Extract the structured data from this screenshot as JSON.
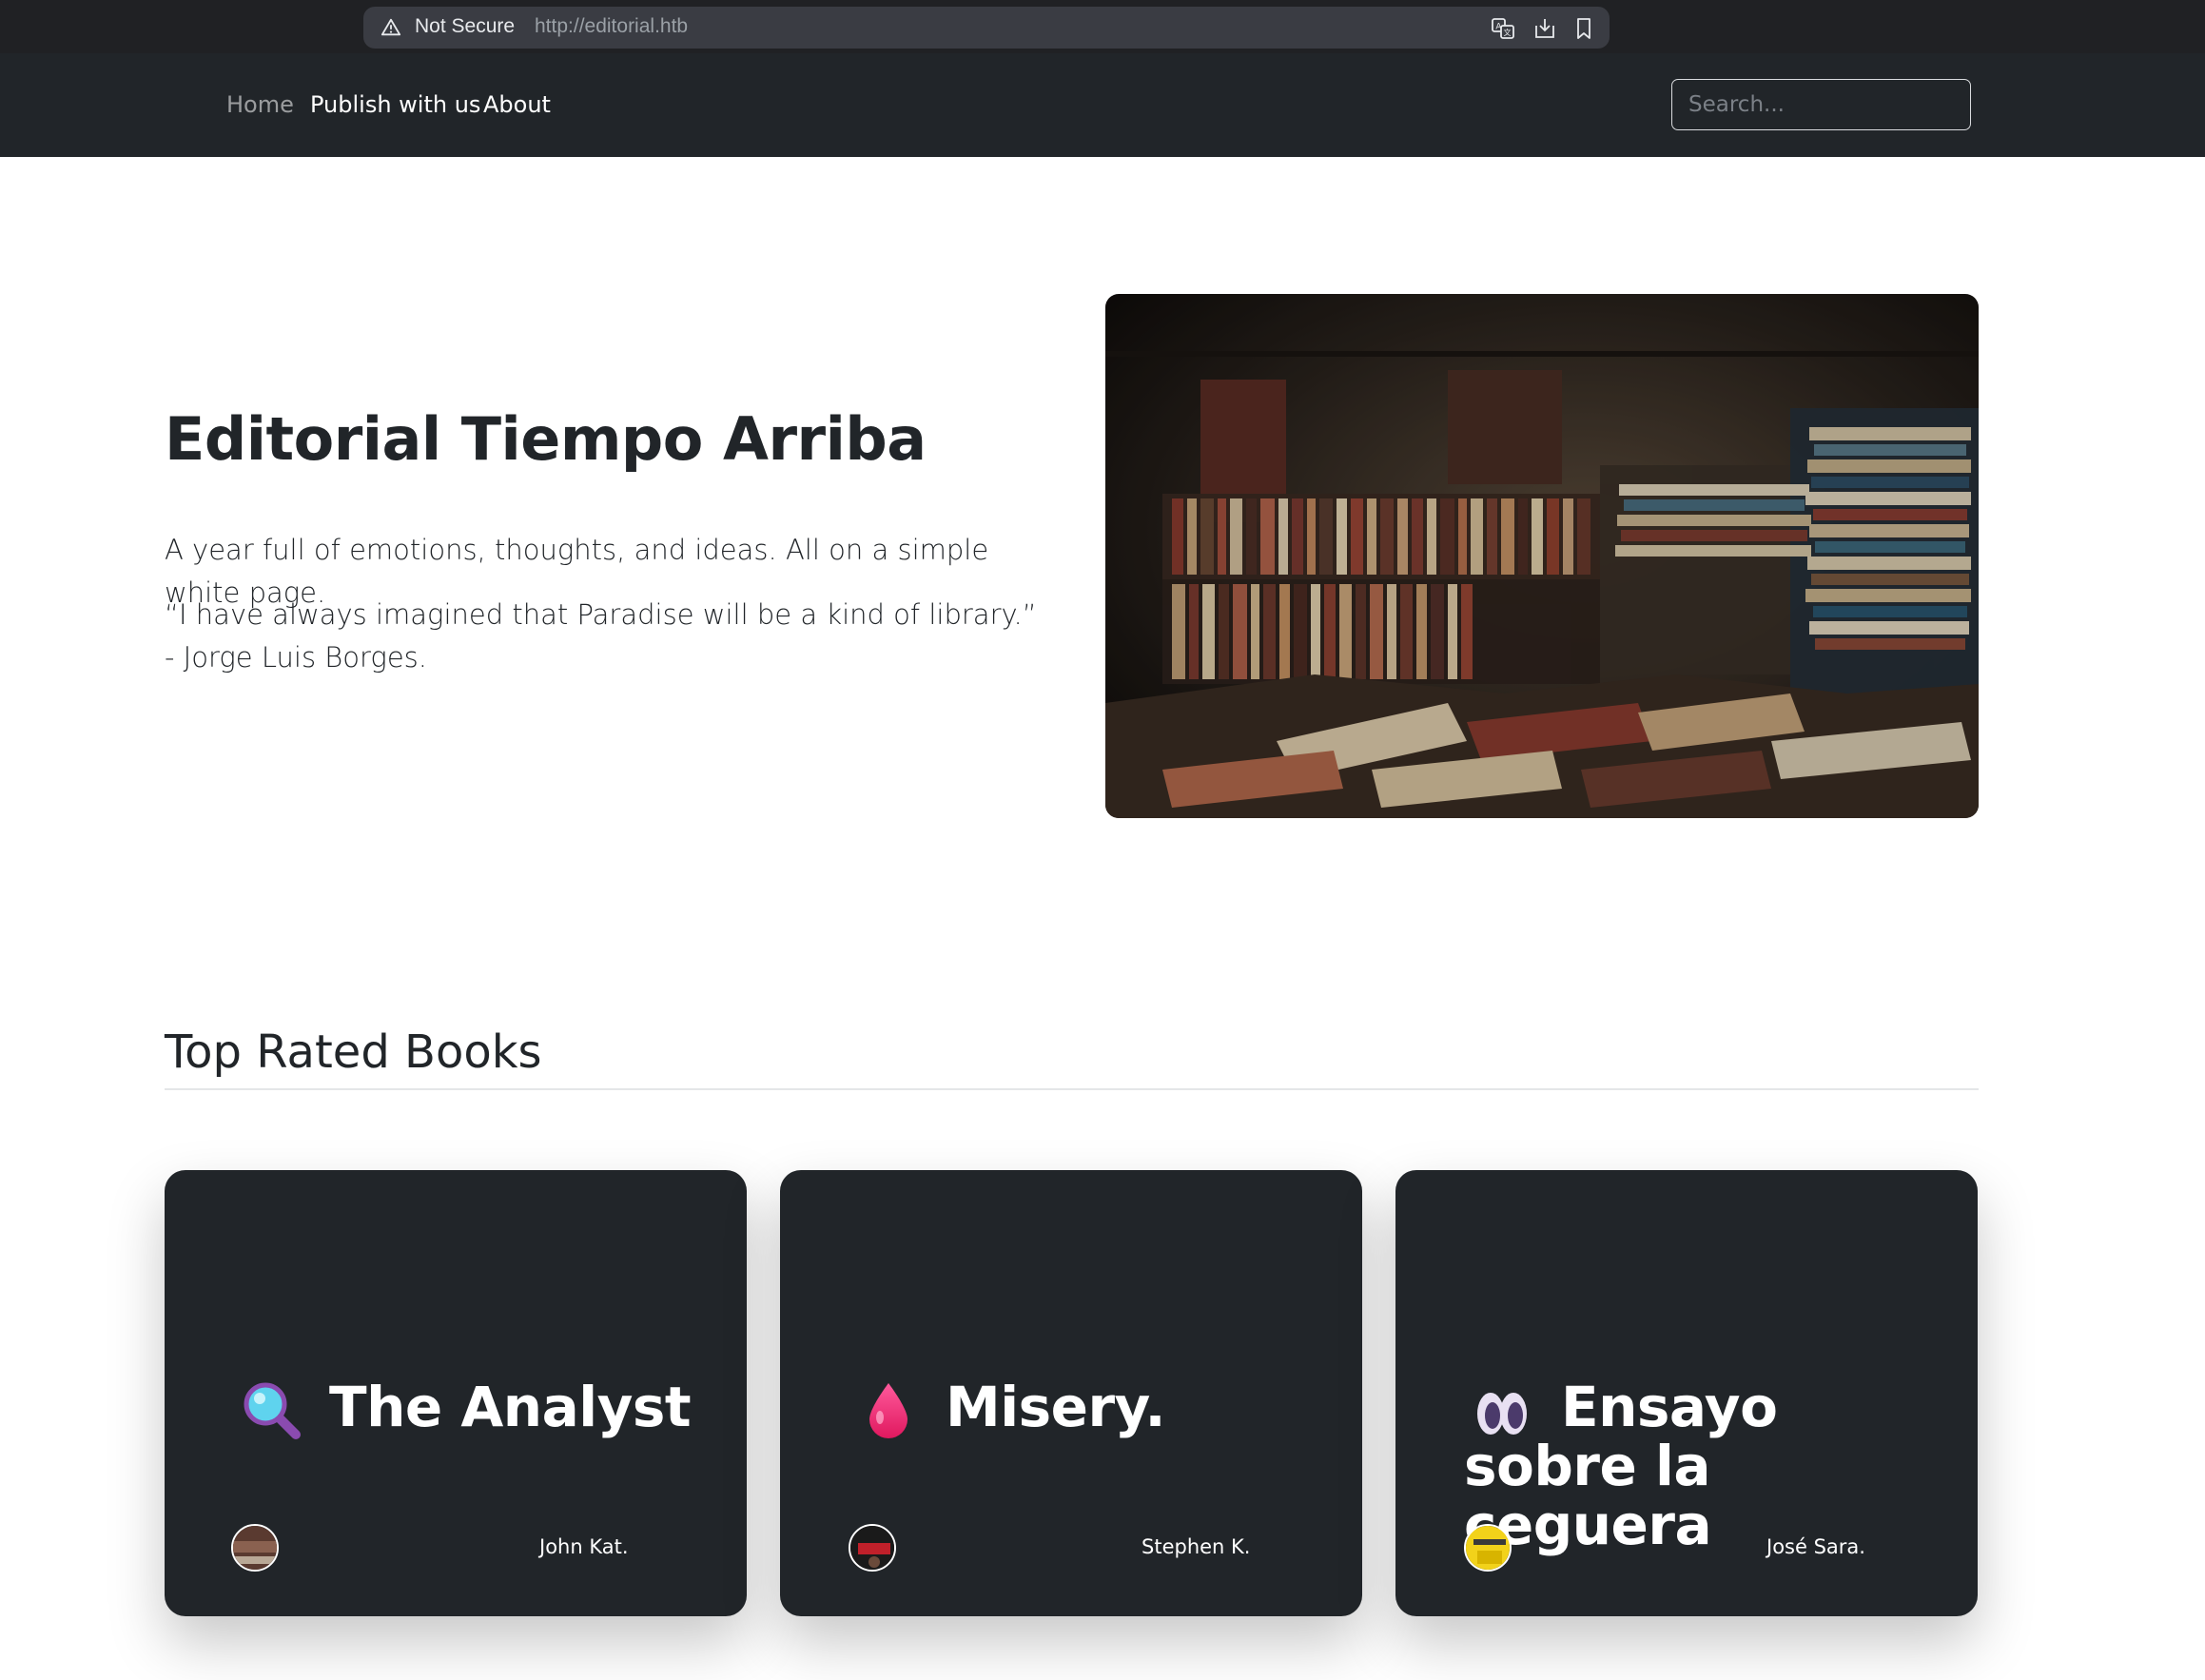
{
  "browser": {
    "security_label": "Not Secure",
    "url": "http://editorial.htb",
    "icons": [
      "warning-icon",
      "translate-icon",
      "download-icon",
      "bookmark-icon"
    ]
  },
  "nav": {
    "links": [
      {
        "label": "Home",
        "active": true
      },
      {
        "label": "Publish with us"
      },
      {
        "label": "About"
      }
    ],
    "search_placeholder": "Search..."
  },
  "hero": {
    "title": "Editorial Tiempo Arriba",
    "lead": "A year full of emotions, thoughts, and ideas. All on a simple white page.",
    "quote": "“I have always imagined that Paradise will be a kind of library.” - Jorge Luis Borges."
  },
  "top_rated": {
    "title": "Top Rated Books",
    "books": [
      {
        "title": "The Analyst",
        "author": "John Kat.",
        "emoji": "magnifying-glass-icon"
      },
      {
        "title": "Misery.",
        "author": "Stephen K.",
        "emoji": "blood-drop-icon"
      },
      {
        "title": "Ensayo sobre la ceguera",
        "author": "José Sara.",
        "emoji": "eyes-icon"
      }
    ]
  },
  "colors": {
    "navbar": "#212529",
    "card": "#212529",
    "browser_chrome": "#202124",
    "text": "#212529"
  }
}
